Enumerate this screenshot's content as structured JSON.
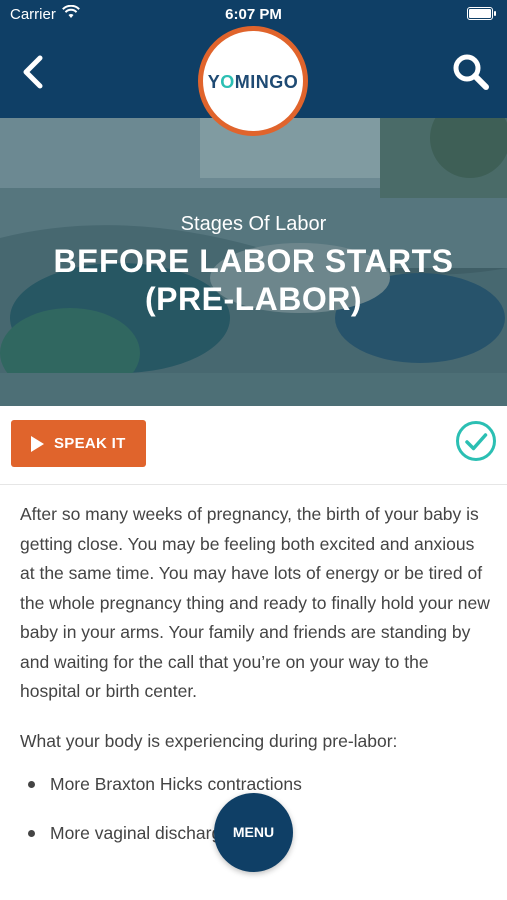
{
  "status_bar": {
    "carrier": "Carrier",
    "time": "6:07 PM"
  },
  "header": {
    "logo_text_pre": "Y",
    "logo_text_o": "O",
    "logo_text_post": "MINGO"
  },
  "hero": {
    "subtitle": "Stages Of Labor",
    "title": "BEFORE LABOR STARTS (PRE-LABOR)"
  },
  "actions": {
    "speak_label": "SPEAK IT"
  },
  "content": {
    "paragraph": "After so many weeks of pregnancy, the birth of your baby is getting close. You may be feeling both excited and anxious at the same time. You may have lots of energy or be tired of the whole pregnancy thing and ready to finally hold your new baby in your arms. Your family and friends are standing by and waiting for the call that you’re on your way to the hospital or birth center.",
    "lead": "What your body is experiencing during pre-labor:",
    "bullets": [
      "More Braxton Hicks contractions",
      "More vaginal discharge"
    ]
  },
  "menu": {
    "label": "MENU"
  },
  "colors": {
    "navy": "#0f3f66",
    "orange": "#e0642c",
    "teal": "#2bbfb3"
  }
}
